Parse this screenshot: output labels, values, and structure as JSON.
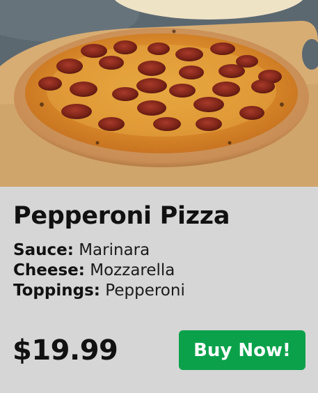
{
  "product": {
    "name": "Pepperoni Pizza",
    "details": [
      {
        "label": "Sauce:",
        "value": "Marinara"
      },
      {
        "label": "Cheese:",
        "value": "Mozzarella"
      },
      {
        "label": "Toppings:",
        "value": "Pepperoni"
      }
    ],
    "price": "$19.99",
    "buy_label": "Buy Now!"
  },
  "colors": {
    "card_background": "#d6d6d6",
    "button_background": "#0ba14b",
    "button_text": "#ffffff"
  }
}
